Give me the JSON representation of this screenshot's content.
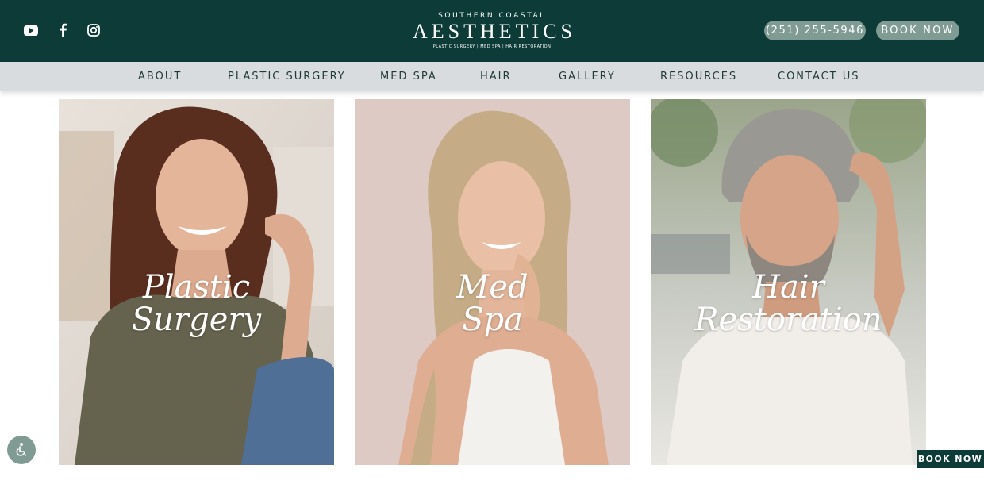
{
  "header": {
    "social": [
      {
        "icon": "youtube-icon"
      },
      {
        "icon": "facebook-icon"
      },
      {
        "icon": "instagram-icon"
      }
    ],
    "logo": {
      "kicker": "SOUTHERN COASTAL",
      "main": "AESTHETICS",
      "tagline": "PLASTIC SURGERY  |  MED SPA  |  HAIR RESTORATION"
    },
    "phone_label": "(251) 255-5946",
    "book_label": "BOOK NOW"
  },
  "nav": {
    "items": [
      {
        "label": "ABOUT"
      },
      {
        "label": "PLASTIC SURGERY"
      },
      {
        "label": "MED SPA"
      },
      {
        "label": "HAIR"
      },
      {
        "label": "GALLERY"
      },
      {
        "label": "RESOURCES"
      },
      {
        "label": "CONTACT US"
      }
    ]
  },
  "cards": [
    {
      "line1": "Plastic",
      "line2": "Surgery",
      "photo": "smiling brunette woman in olive shirt"
    },
    {
      "line1": "Med",
      "line2": "Spa",
      "photo": "smiling blonde woman touching face"
    },
    {
      "line1": "Hair",
      "line2": "Restoration",
      "photo": "grey-haired man touching hairline"
    }
  ],
  "widgets": {
    "accessibility_icon": "accessibility-icon",
    "book_tab_label": "BOOK NOW"
  },
  "colors": {
    "header_bg": "#0c3b38",
    "pill_bg": "#7f9b93",
    "nav_bg": "#d9dcde",
    "nav_text": "#1f3a38"
  }
}
